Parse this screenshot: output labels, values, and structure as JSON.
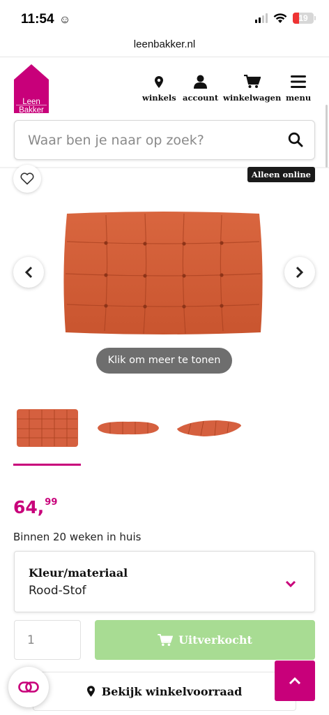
{
  "status_bar": {
    "time": "11:54",
    "time_emoji": "☺",
    "battery": "19"
  },
  "browser": {
    "url": "leenbakker.nl"
  },
  "header": {
    "logo_line1": "Leen",
    "logo_line2": "Bakker",
    "nav": [
      {
        "label": "winkels",
        "icon": "map-pin-icon"
      },
      {
        "label": "account",
        "icon": "user-icon"
      },
      {
        "label": "winkelwagen",
        "icon": "cart-icon"
      },
      {
        "label": "menu",
        "icon": "hamburger-icon"
      }
    ],
    "brand_color": "#c8007a"
  },
  "search": {
    "placeholder": "Waar ben je naar op zoek?",
    "icon": "search-icon"
  },
  "gallery": {
    "badge": "Alleen online",
    "show_more": "Klik om meer te tonen",
    "thumbnails": [
      "cushion-front",
      "cushion-side",
      "cushion-angle"
    ],
    "selected_thumbnail": 1
  },
  "product": {
    "price_main": "64,",
    "price_cents": "99",
    "delivery": "Binnen 20 weken in huis",
    "variant_label": "Kleur/materiaal",
    "variant_value": "Rood-Stof",
    "quantity": "1",
    "buy_label": "Uitverkocht",
    "stock_label": "Bekijk winkelvoorraad",
    "cushion_color": "#d5603f",
    "buy_color": "#a8dc93"
  }
}
